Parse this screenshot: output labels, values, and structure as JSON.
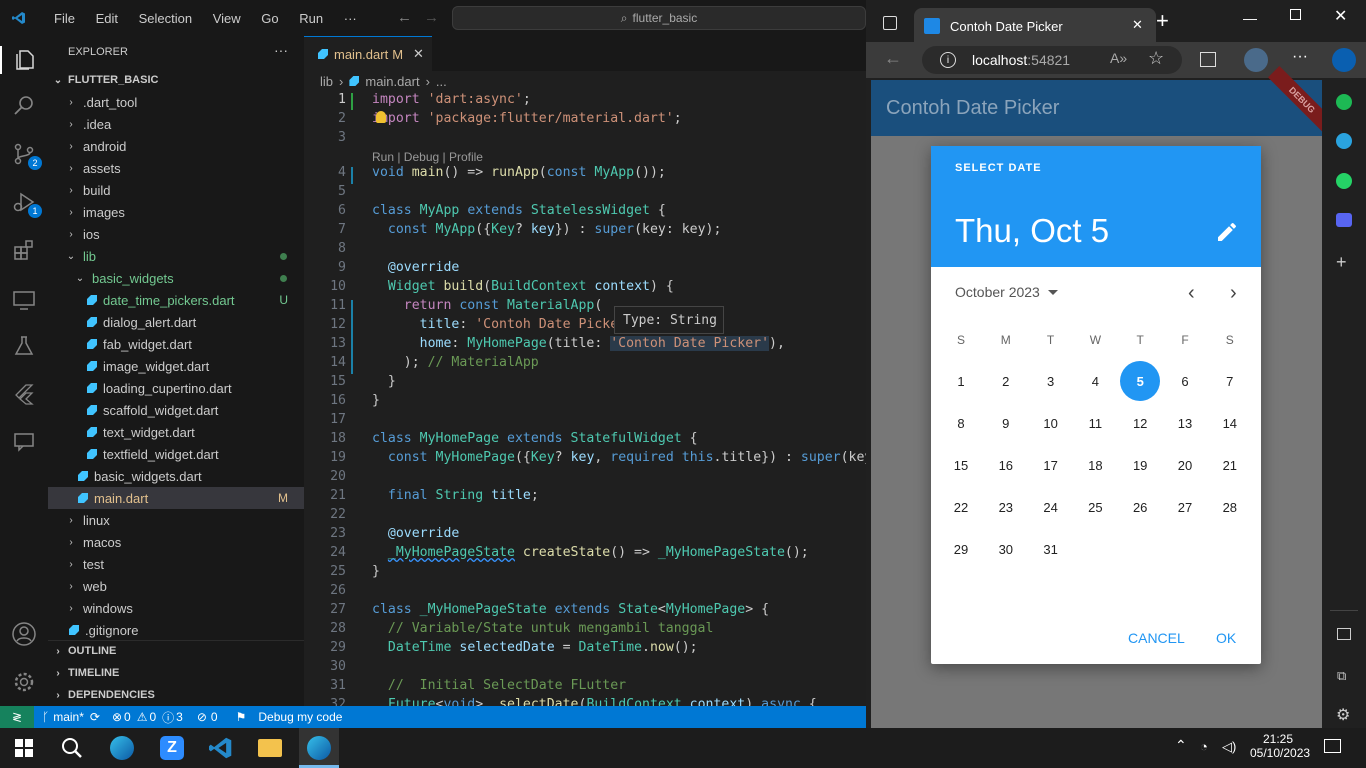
{
  "vscode": {
    "menu": [
      "File",
      "Edit",
      "Selection",
      "View",
      "Go",
      "Run",
      "···"
    ],
    "search": "flutter_basic",
    "explorer_title": "EXPLORER",
    "project": "FLUTTER_BASIC",
    "tree": [
      {
        "label": ".dart_tool",
        "type": "folder"
      },
      {
        "label": ".idea",
        "type": "folder"
      },
      {
        "label": "android",
        "type": "folder"
      },
      {
        "label": "assets",
        "type": "folder"
      },
      {
        "label": "build",
        "type": "folder"
      },
      {
        "label": "images",
        "type": "folder"
      },
      {
        "label": "ios",
        "type": "folder"
      },
      {
        "label": "lib",
        "type": "folder-open"
      },
      {
        "label": "basic_widgets",
        "type": "folder-open"
      },
      {
        "label": "date_time_pickers.dart",
        "type": "file",
        "flag": "U"
      },
      {
        "label": "dialog_alert.dart",
        "type": "file"
      },
      {
        "label": "fab_widget.dart",
        "type": "file"
      },
      {
        "label": "image_widget.dart",
        "type": "file"
      },
      {
        "label": "loading_cupertino.dart",
        "type": "file"
      },
      {
        "label": "scaffold_widget.dart",
        "type": "file"
      },
      {
        "label": "text_widget.dart",
        "type": "file"
      },
      {
        "label": "textfield_widget.dart",
        "type": "file"
      },
      {
        "label": "basic_widgets.dart",
        "type": "file"
      },
      {
        "label": "main.dart",
        "type": "file",
        "flag": "M"
      },
      {
        "label": "linux",
        "type": "folder"
      },
      {
        "label": "macos",
        "type": "folder"
      },
      {
        "label": "test",
        "type": "folder"
      },
      {
        "label": "web",
        "type": "folder"
      },
      {
        "label": "windows",
        "type": "folder"
      },
      {
        "label": ".gitignore",
        "type": "file"
      }
    ],
    "sections": [
      "OUTLINE",
      "TIMELINE",
      "DEPENDENCIES"
    ],
    "tab_label": "main.dart",
    "tab_flag": "M",
    "breadcrumb": [
      "lib",
      "main.dart",
      "..."
    ],
    "codelens": "Run | Debug | Profile",
    "hover": {
      "label": "Type:",
      "value": "String"
    },
    "badges": {
      "scm": "2",
      "debug": "1"
    },
    "status": {
      "branch": "main*",
      "errors": "0",
      "warnings": "0",
      "info": "3",
      "ports": "0",
      "debug": "Debug my code"
    }
  },
  "edge": {
    "tab_title": "Contoh Date Picker",
    "url_host": "localhost",
    "url_port": ":54821"
  },
  "app": {
    "title": "Contoh Date Picker",
    "debug_banner": "DEBUG",
    "dialog": {
      "header_label": "SELECT DATE",
      "selected": "Thu, Oct 5",
      "month_label": "October 2023",
      "weekdays": [
        "S",
        "M",
        "T",
        "W",
        "T",
        "F",
        "S"
      ],
      "days": [
        "1",
        "2",
        "3",
        "4",
        "5",
        "6",
        "7",
        "8",
        "9",
        "10",
        "11",
        "12",
        "13",
        "14",
        "15",
        "16",
        "17",
        "18",
        "19",
        "20",
        "21",
        "22",
        "23",
        "24",
        "25",
        "26",
        "27",
        "28",
        "29",
        "30",
        "31"
      ],
      "selected_day": "5",
      "cancel": "CANCEL",
      "ok": "OK"
    }
  },
  "taskbar": {
    "time": "21:25",
    "date": "05/10/2023"
  },
  "colors": {
    "accent": "#2196f3",
    "vscode_blue": "#0078d4",
    "appbar": "#1a4f7d"
  }
}
